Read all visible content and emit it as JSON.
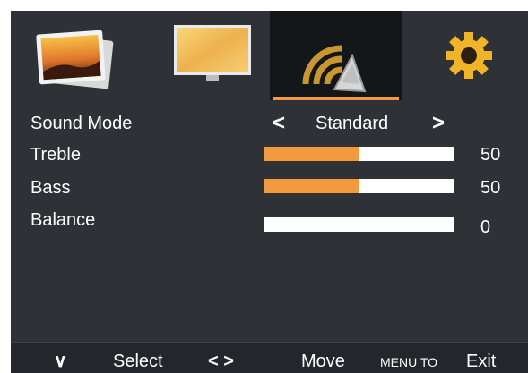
{
  "menu": {
    "tabs": [
      {
        "id": "picture",
        "icon": "picture-icon"
      },
      {
        "id": "screen",
        "icon": "screen-icon"
      },
      {
        "id": "sound",
        "icon": "sound-icon",
        "selected": true
      },
      {
        "id": "setup",
        "icon": "gear-icon"
      }
    ],
    "accent_color": "#f39a3c",
    "background_color": "#2e3236"
  },
  "sound_mode": {
    "label": "Sound Mode",
    "value": "Standard",
    "left_arrow": "<",
    "right_arrow": ">"
  },
  "treble": {
    "label": "Treble",
    "value": "50",
    "fill_fraction": 0.5
  },
  "bass": {
    "label": "Bass",
    "value": "50",
    "fill_fraction": 0.5
  },
  "balance": {
    "label": "Balance",
    "value": "0",
    "fill_fraction": 0
  },
  "hints": {
    "down_glyph": "∨",
    "select": "Select",
    "left_right_glyph": "< >",
    "move": "Move",
    "menu_to": "MENU TO",
    "exit": "Exit"
  }
}
